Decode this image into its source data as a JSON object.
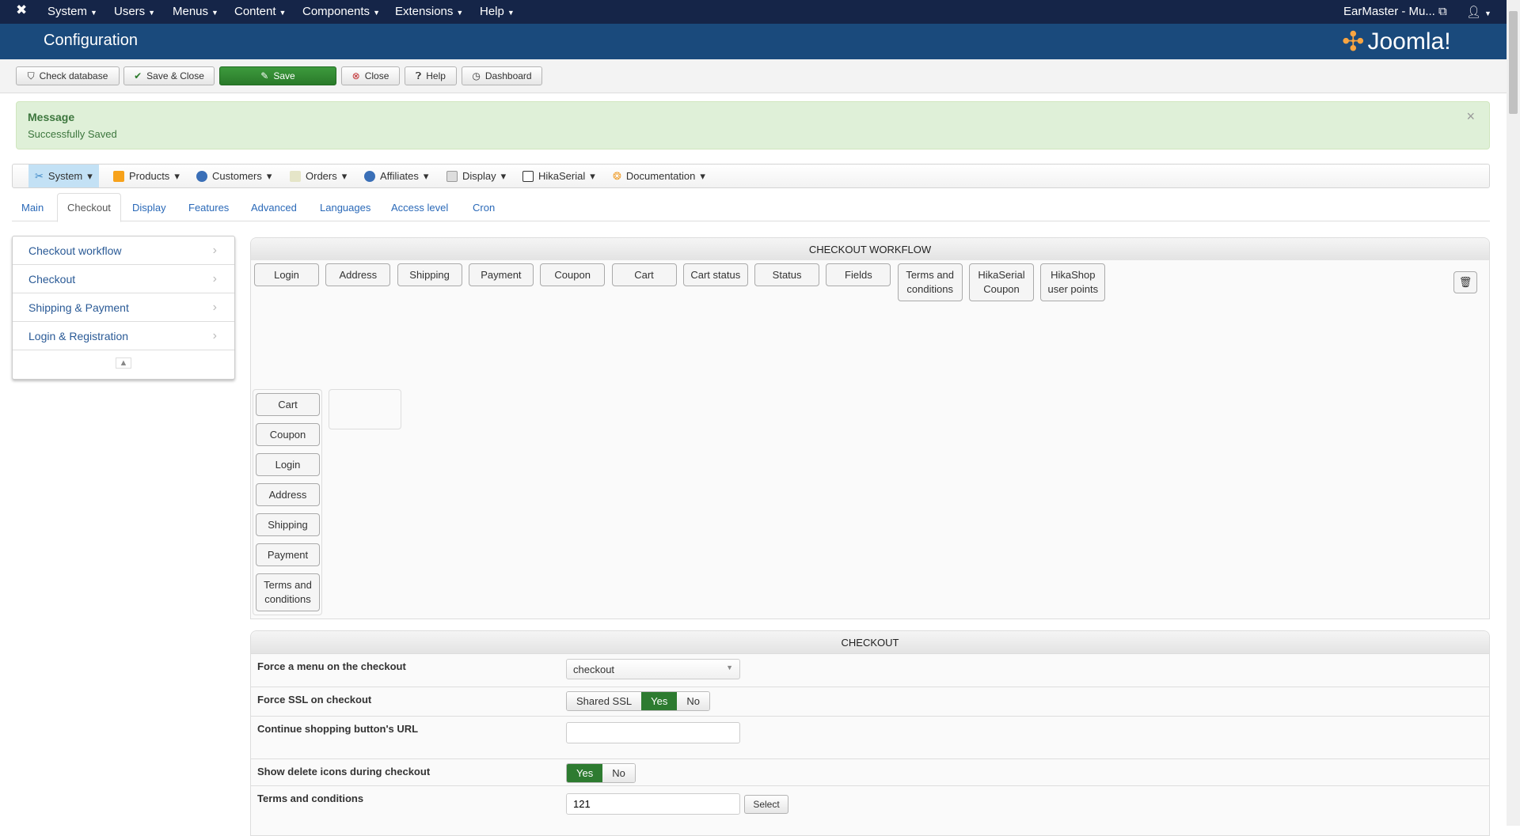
{
  "topbar": {
    "menus": [
      "System",
      "Users",
      "Menus",
      "Content",
      "Components",
      "Extensions",
      "Help"
    ],
    "site": "EarMaster - Mu..."
  },
  "header": {
    "title": "Configuration",
    "logo": "Joomla!"
  },
  "toolbar": {
    "check_db": "Check database",
    "save_close": "Save & Close",
    "save": "Save",
    "close": "Close",
    "help": "Help",
    "dashboard": "Dashboard"
  },
  "message": {
    "heading": "Message",
    "text": "Successfully Saved",
    "close": "×"
  },
  "menubar": [
    "System",
    "Products",
    "Customers",
    "Orders",
    "Affiliates",
    "Display",
    "HikaSerial",
    "Documentation"
  ],
  "tabs": [
    "Main",
    "Checkout",
    "Display",
    "Features",
    "Advanced",
    "Languages",
    "Access level",
    "Cron"
  ],
  "sidebar": [
    "Checkout workflow",
    "Checkout",
    "Shipping & Payment",
    "Login & Registration"
  ],
  "workflow": {
    "title": "CHECKOUT WORKFLOW",
    "available": [
      "Login",
      "Address",
      "Shipping",
      "Payment",
      "Coupon",
      "Cart",
      "Cart status",
      "Status",
      "Fields",
      "Terms and conditions",
      "HikaSerial Coupon",
      "HikaShop user points"
    ],
    "step1": [
      "Cart",
      "Coupon",
      "Login",
      "Address",
      "Shipping",
      "Payment",
      "Terms and conditions"
    ]
  },
  "checkout": {
    "title": "CHECKOUT",
    "force_menu": {
      "label": "Force a menu on the checkout",
      "value": "checkout"
    },
    "force_ssl": {
      "label": "Force SSL on checkout",
      "options": [
        "Shared SSL",
        "Yes",
        "No"
      ],
      "selected": "Yes"
    },
    "continue_url": {
      "label": "Continue shopping button's URL",
      "value": ""
    },
    "delete_icons": {
      "label": "Show delete icons during checkout",
      "options": [
        "Yes",
        "No"
      ],
      "selected": "Yes"
    },
    "terms": {
      "label": "Terms and conditions",
      "value": "121",
      "button": "Select"
    }
  },
  "colors": {
    "topbar": "#152548",
    "header": "#1a4a7c",
    "success": "#2d7b30"
  }
}
